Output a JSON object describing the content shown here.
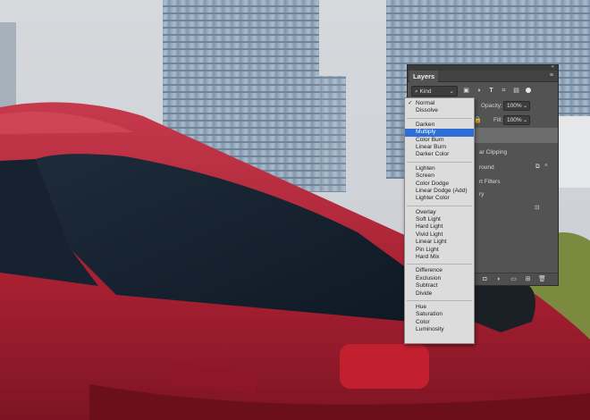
{
  "panel": {
    "title": "Layers",
    "menu_icon": "panel-menu-icon",
    "kind_label": "Kind",
    "filter_icons": [
      "image-filter-icon",
      "adjustment-filter-icon",
      "type-filter-icon",
      "shape-filter-icon",
      "smart-object-filter-icon"
    ],
    "opacity_label": "Opacity:",
    "opacity_value": "100%",
    "lock_icon": "lock-icon",
    "fill_label": "Fill:",
    "fill_value": "100%",
    "layers": {
      "clipping_text": "ar Clipping",
      "background_text": "round",
      "smart_filters_text": "rt Filters",
      "filter_name_text": "ry"
    },
    "bottom_icons": [
      "mask-icon",
      "adjustment-icon",
      "group-folder-icon",
      "new-layer-icon",
      "trash-icon"
    ]
  },
  "blend_menu": {
    "checked": "Normal",
    "selected": "Multiply",
    "groups": [
      [
        "Normal",
        "Dissolve"
      ],
      [
        "Darken",
        "Multiply",
        "Color Burn",
        "Linear Burn",
        "Darker Color"
      ],
      [
        "Lighten",
        "Screen",
        "Color Dodge",
        "Linear Dodge (Add)",
        "Lighter Color"
      ],
      [
        "Overlay",
        "Soft Light",
        "Hard Light",
        "Vivid Light",
        "Linear Light",
        "Pin Light",
        "Hard Mix"
      ],
      [
        "Difference",
        "Exclusion",
        "Subtract",
        "Divide"
      ],
      [
        "Hue",
        "Saturation",
        "Color",
        "Luminosity"
      ]
    ]
  },
  "colors": {
    "panel_bg": "#535353",
    "menu_bg": "#dcdcdc",
    "selected_item": "#2d6fd6",
    "car_red": "#b3263a"
  }
}
